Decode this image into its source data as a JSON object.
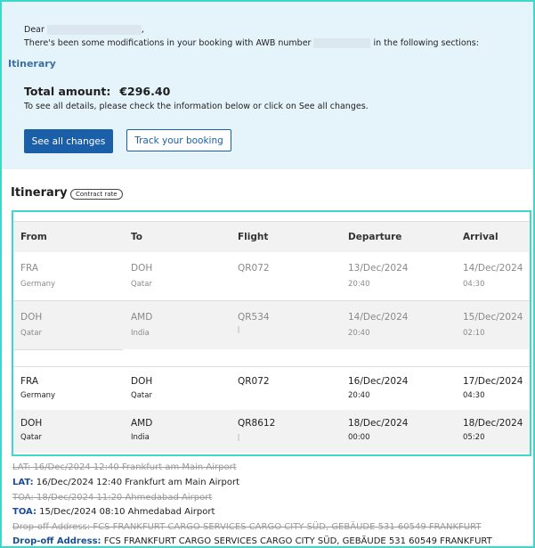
{
  "greeting": {
    "dear": "Dear",
    "comma": ","
  },
  "modifications_before": "There's been some modifications in your booking with AWB number",
  "modifications_after": "in the following sections:",
  "section_link": "Itinerary",
  "total": {
    "label": "Total amount:",
    "value": "€296.40"
  },
  "info_text": "To see all details, please check the information below or click on See all changes.",
  "buttons": {
    "see_all": "See all changes",
    "track": "Track your booking"
  },
  "itinerary": {
    "title": "Itinerary",
    "badge": "Contract rate",
    "headers": [
      "From",
      "To",
      "Flight",
      "Departure",
      "Arrival"
    ],
    "old_rows": [
      {
        "from": "FRA",
        "from_country": "Germany",
        "to": "DOH",
        "to_country": "Qatar",
        "flight": "QR072",
        "dep_date": "13/Dec/2024",
        "dep_time": "20:40",
        "arr_date": "14/Dec/2024",
        "arr_time": "04:30"
      },
      {
        "from": "DOH",
        "from_country": "Qatar",
        "to": "AMD",
        "to_country": "India",
        "flight": "QR534",
        "dep_date": "14/Dec/2024",
        "dep_time": "20:40",
        "arr_date": "15/Dec/2024",
        "arr_time": "02:10"
      }
    ],
    "new_rows": [
      {
        "from": "FRA",
        "from_country": "Germany",
        "to": "DOH",
        "to_country": "Qatar",
        "flight": "QR072",
        "dep_date": "16/Dec/2024",
        "dep_time": "20:40",
        "arr_date": "17/Dec/2024",
        "arr_time": "04:30"
      },
      {
        "from": "DOH",
        "from_country": "Qatar",
        "to": "AMD",
        "to_country": "India",
        "flight": "QR8612",
        "dep_date": "18/Dec/2024",
        "dep_time": "00:00",
        "arr_date": "18/Dec/2024",
        "arr_time": "05:20"
      }
    ]
  },
  "details": {
    "lat_label": "LAT:",
    "lat_old": "16/Dec/2024 12:40 Frankfurt am Main Airport",
    "lat_new": "16/Dec/2024 12:40 Frankfurt am Main Airport",
    "toa_label": "TOA:",
    "toa_old": "18/Dec/2024 11:20 Ahmedabad Airport",
    "toa_new": "15/Dec/2024 08:10 Ahmedabad Airport",
    "dropoff_label": "Drop-off Address:",
    "dropoff_old": "FCS FRANKFURT CARGO SERVICES CARGO CITY SÜD, GEBÄUDE 531 60549 FRANKFURT",
    "dropoff_new": "FCS FRANKFURT CARGO SERVICES CARGO CITY SÜD, GEBÄUDE 531 60549 FRANKFURT"
  }
}
